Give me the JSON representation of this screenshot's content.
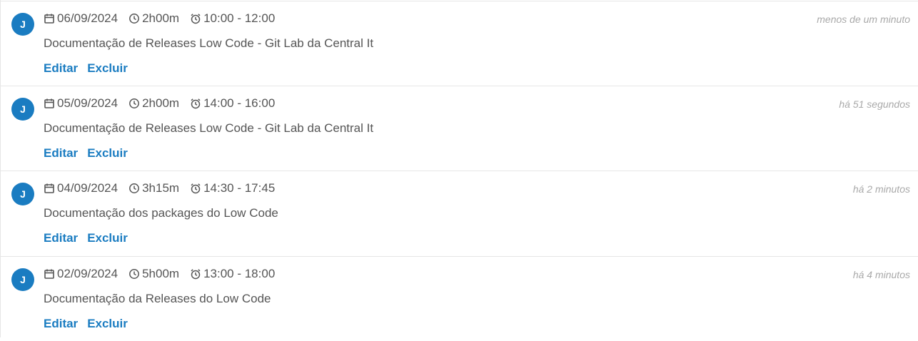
{
  "entries": [
    {
      "avatar": "J",
      "date": "06/09/2024",
      "duration": "2h00m",
      "time_range": "10:00 - 12:00",
      "time_ago": "menos de um minuto",
      "description": "Documentação de Releases Low Code - Git Lab da Central It",
      "edit_label": "Editar",
      "delete_label": "Excluir"
    },
    {
      "avatar": "J",
      "date": "05/09/2024",
      "duration": "2h00m",
      "time_range": "14:00 - 16:00",
      "time_ago": "há 51 segundos",
      "description": "Documentação de Releases Low Code - Git Lab da Central It",
      "edit_label": "Editar",
      "delete_label": "Excluir"
    },
    {
      "avatar": "J",
      "date": "04/09/2024",
      "duration": "3h15m",
      "time_range": "14:30 - 17:45",
      "time_ago": "há 2 minutos",
      "description": "Documentação dos packages do Low Code",
      "edit_label": "Editar",
      "delete_label": "Excluir"
    },
    {
      "avatar": "J",
      "date": "02/09/2024",
      "duration": "5h00m",
      "time_range": "13:00 - 18:00",
      "time_ago": "há 4 minutos",
      "description": "Documentação da Releases do Low Code",
      "edit_label": "Editar",
      "delete_label": "Excluir"
    }
  ],
  "colors": {
    "accent": "#1a7cc1",
    "text": "#555555",
    "muted": "#a9a9a9",
    "divider": "#e6e6e6"
  },
  "icons": {
    "date": "calendar-icon",
    "duration": "clock-icon",
    "time_range": "alarm-clock-icon"
  }
}
